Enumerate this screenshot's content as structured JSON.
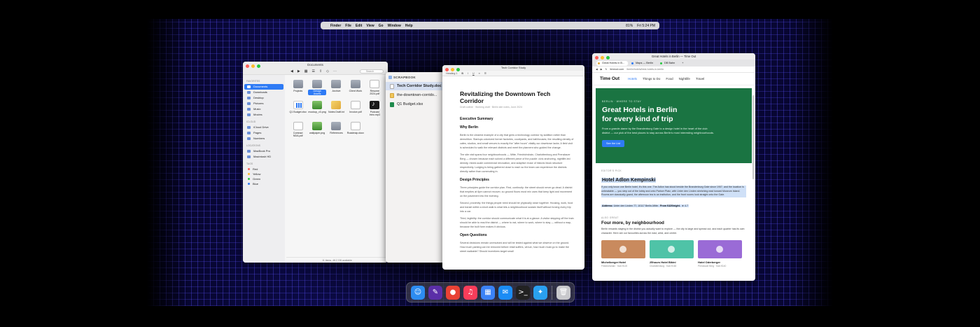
{
  "menubar": {
    "apple": "",
    "items": [
      "Finder",
      "File",
      "Edit",
      "View",
      "Go",
      "Window",
      "Help"
    ],
    "battery": "81%",
    "clock": "Fri 5:24 PM"
  },
  "finder": {
    "title": "Documents",
    "search_placeholder": "Search",
    "sidebar": {
      "favorites_head": "Favorites",
      "favorites": [
        "Documents",
        "Downloads",
        "Desktop",
        "Pictures",
        "Music",
        "Movies"
      ],
      "icloud_head": "iCloud",
      "icloud": [
        "iCloud Drive",
        "Pages",
        "Numbers"
      ],
      "locations_head": "Locations",
      "locations": [
        "MacBook Pro",
        "Macintosh HD"
      ],
      "tags_head": "Tags",
      "tags": [
        {
          "name": "Red",
          "color": "#ff5f57"
        },
        {
          "name": "Yellow",
          "color": "#febc2e"
        },
        {
          "name": "Green",
          "color": "#28c840"
        },
        {
          "name": "Blue",
          "color": "#2f7bf5"
        }
      ]
    },
    "files": [
      {
        "name": "Projects",
        "kind": "folder"
      },
      {
        "name": "Design Assets",
        "kind": "folder",
        "selected": true
      },
      {
        "name": "Archive",
        "kind": "folder"
      },
      {
        "name": "Client Work",
        "kind": "folder"
      },
      {
        "name": "Resume 2024.pdf",
        "kind": "doc"
      },
      {
        "name": "Q1 Budget.xlsx",
        "kind": "chart"
      },
      {
        "name": "mockup_v3.png",
        "kind": "img"
      },
      {
        "name": "Notes Draft.txt",
        "kind": "pen"
      },
      {
        "name": "Invoice.pdf",
        "kind": "doc"
      },
      {
        "name": "Podcast Intro.mp3",
        "kind": "note"
      },
      {
        "name": "Contract NDA.pdf",
        "kind": "doc"
      },
      {
        "name": "wallpaper.png",
        "kind": "img"
      },
      {
        "name": "References",
        "kind": "folder"
      },
      {
        "name": "Roadmap.docx",
        "kind": "doc"
      }
    ],
    "status": "11 items, 48.2 GB available"
  },
  "scrapbook": {
    "title": "SCRAPBOOK",
    "items": [
      {
        "name": "Tech Corridor Study.doc",
        "kind": "doc",
        "selected": true
      },
      {
        "name": "the-downtown-corrido...",
        "kind": "dl"
      },
      {
        "name": "Q1 Budget.xlsx",
        "kind": "xl"
      }
    ]
  },
  "document": {
    "window_title": "Tech Corridor Study",
    "toolbar_style": "Heading 1",
    "title": "Revitalizing the Downtown Tech Corridor",
    "byline": "Draft outline · Working draft · Berlin site notes, June 2024",
    "sections": [
      {
        "heading": "Executive Summary",
        "paras": []
      },
      {
        "heading": "Why Berlin",
        "paras": [
          "Berlin is the clearest example of a city that grew a technology corridor by addition rather than demolition. Startups colonized former factories, courtyards, and bathhouses; the resulting density of cafes, studios, and small venues is exactly the \"after hours\" vitality our downtown lacks. A field visit is scheduled to walk the relevant districts and meet the planners who guided the change.",
          "The site visit spans four neighbourhoods — Mitte, Friedrichshain, Charlottenburg and Prenzlauer Berg — chosen because each solved a different piece of the puzzle: civic anchoring, nightlife-led density, mixed-scale commercial renovation, and adaptive reuse of historic block structure respectively. Lodging is being gathered close to each so the team can experience the districts directly rather than commuting in."
        ]
      },
      {
        "heading": "Design Principles",
        "paras": [
          "Three principles guide the corridor plan. First, continuity: the street should never go dead. A district that empties at 6pm cannot recover, so ground floors must mix uses that keep light and movement on the pavement into the evening.",
          "Second, proximity: the things people need should be physically close together. Housing, work, food and transit within a short walk is what lets a neighbourhood sustain itself without forcing every trip into a car.",
          "Third, legibility: the corridor should communicate what it is at a glance. A visitor stepping off the train should be able to read the district — where to eat, where to work, where to stay — without a map, because the built form makes it obvious."
        ]
      },
      {
        "heading": "Open Questions",
        "paras": [
          "Several decisions remain unresolved and will be tested against what we observe on the ground. How much parking can be removed before retail suffers, venue, how much must go to make the street walkable? Should incentives target small"
        ]
      }
    ]
  },
  "browser": {
    "window_title": "Great Hotels in Berlin — Time Out",
    "tabs": [
      {
        "label": "Great Hotels in B...",
        "color": "#e0a93a",
        "active": true
      },
      {
        "label": "Maps — Berlin",
        "color": "#2f7bf5",
        "active": false
      },
      {
        "label": "DB Bahn",
        "color": "#28c840",
        "active": false
      }
    ],
    "address": "timeout.com",
    "address_path": "/berlin/hotels/best-hotels-in-berlin",
    "nav": {
      "logo": "Time Out",
      "items": [
        "Hotels",
        "Things to Do",
        "Food",
        "Nightlife",
        "Travel"
      ]
    },
    "hero": {
      "kicker": "BERLIN · WHERE TO STAY",
      "title_line1": "Great Hotels in Berlin",
      "title_line2": "for every kind of trip",
      "text": "From a grande-dame by the Brandenburg Gate to a design hotel in the heart of the club district — our pick of the best places to stay across Berlin's most interesting neighbourhoods.",
      "button": "See the List"
    },
    "editors_pick": "EDITOR'S PICK",
    "pick_title": "Hotel Adlon Kempinski",
    "pick_text": "If you only know one Berlin hotel, it's this one. The Adlon has stood beside the Brandenburg Gate since 1907, and the location is unbeatable — you step out of the lobby and onto Pariser Platz, with Unter den Linden stretching east toward Museum Island. Rooms are classically grand, the afternoon tea is an institution, and the front rooms look straight onto the Gate.",
    "address_label": "Address:",
    "address_value": "Unter den Linden 77, 10117 Berlin-Mitte.",
    "price_label": "From €420/night.",
    "rating": "★ 4.7",
    "also_great": "ALSO GREAT",
    "section_title": "Four more, by neighbourhood",
    "section_text": "Berlin rewards staying in the district you actually want to explore — the city is large and spread out, and each quarter has its own character. Here are our favourites across the east, west, and centre.",
    "cards": [
      {
        "title": "Michelberger Hotel",
        "desc": "Friedrichshain · from €120",
        "color": "#c98a5e"
      },
      {
        "title": "25hours Hotel Bikini",
        "desc": "Charlottenburg · from €160",
        "color": "#4fc3a7"
      },
      {
        "title": "Hotel Oderberger",
        "desc": "Prenzlauer Berg · from €140",
        "color": "#9a6bd6"
      }
    ]
  },
  "dock": {
    "apps": [
      {
        "name": "finder",
        "glyph": "☺",
        "color": "#2d8cf0"
      },
      {
        "name": "notes",
        "glyph": "✎",
        "color": "#5b2fa8"
      },
      {
        "name": "chrome",
        "glyph": "●",
        "color": "#e94235"
      },
      {
        "name": "music",
        "glyph": "♫",
        "color": "#fa3d5a"
      },
      {
        "name": "calendar",
        "glyph": "▦",
        "color": "#3b82f6"
      },
      {
        "name": "mail",
        "glyph": "✉",
        "color": "#1b8cf5"
      },
      {
        "name": "terminal",
        "glyph": ">_",
        "color": "#222"
      },
      {
        "name": "safari",
        "glyph": "✦",
        "color": "#2aa0f0"
      },
      {
        "name": "trash",
        "glyph": "🗑",
        "color": "#c8c8cc"
      }
    ]
  }
}
